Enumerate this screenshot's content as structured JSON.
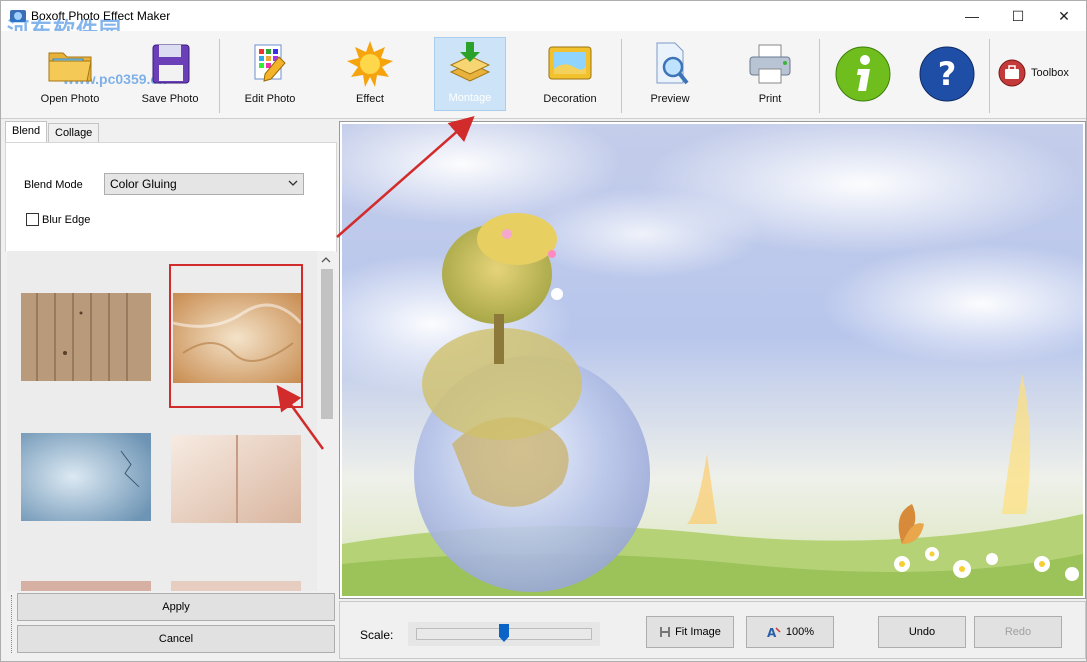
{
  "window": {
    "title": "Boxoft Photo Effect Maker",
    "watermark": "河东软件园",
    "watermark_url": "www.pc0359.cn",
    "controls": {
      "minimize": "—",
      "maximize": "☐",
      "close": "✕"
    }
  },
  "toolbar": {
    "items": [
      {
        "label": "Open Photo",
        "icon": "folder-icon"
      },
      {
        "label": "Save Photo",
        "icon": "floppy-disk-icon"
      },
      {
        "label": "Edit Photo",
        "icon": "edit-grid-pencil-icon"
      },
      {
        "label": "Effect",
        "icon": "sun-icon"
      },
      {
        "label": "Montage",
        "icon": "montage-layers-icon",
        "active": true
      },
      {
        "label": "Decoration",
        "icon": "picture-frame-icon"
      },
      {
        "label": "Preview",
        "icon": "magnifier-document-icon"
      },
      {
        "label": "Print",
        "icon": "printer-icon"
      },
      {
        "label": "",
        "icon": "info-icon"
      },
      {
        "label": "",
        "icon": "help-icon"
      },
      {
        "label": "Toolbox",
        "icon": "toolbox-icon"
      }
    ]
  },
  "leftpanel": {
    "tabs": [
      {
        "label": "Blend",
        "active": true
      },
      {
        "label": "Collage",
        "active": false
      }
    ],
    "blend_mode_label": "Blend Mode",
    "blend_mode_value": "Color Gluing",
    "blur_edge_label": "Blur Edge",
    "blur_edge_checked": false,
    "thumbnails": [
      {
        "name": "wood-planks",
        "selected": false
      },
      {
        "name": "grunge-parchment",
        "selected": true
      },
      {
        "name": "blue-clouds-texture",
        "selected": false
      },
      {
        "name": "old-paper",
        "selected": false
      },
      {
        "name": "texture-5",
        "selected": false
      },
      {
        "name": "texture-6",
        "selected": false
      }
    ],
    "apply_label": "Apply",
    "cancel_label": "Cancel"
  },
  "bottombar": {
    "scale_label": "Scale:",
    "scale_value": 0.5,
    "fit_image_label": "Fit Image",
    "zoom_100_label": "100%",
    "undo_label": "Undo",
    "redo_label": "Redo"
  },
  "colors": {
    "accent": "#d22b2b",
    "active_tool_bg": "#cde3f7",
    "slider_knob": "#0a64c8"
  }
}
